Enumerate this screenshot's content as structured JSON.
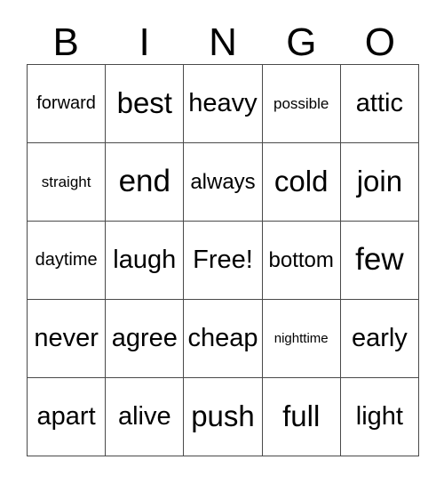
{
  "card": {
    "title": "Bingo Card",
    "background_color": "#ffffff",
    "text_color": "#000000",
    "grid_line_color": "#4a4a4a",
    "columns": 5,
    "rows": 5
  },
  "header": {
    "letters": [
      "B",
      "I",
      "N",
      "G",
      "O"
    ]
  },
  "grid": {
    "rows": [
      {
        "cells": [
          {
            "text": "forward",
            "free_space": false
          },
          {
            "text": "best",
            "free_space": false
          },
          {
            "text": "heavy",
            "free_space": false
          },
          {
            "text": "possible",
            "free_space": false
          },
          {
            "text": "attic",
            "free_space": false
          }
        ]
      },
      {
        "cells": [
          {
            "text": "straight",
            "free_space": false
          },
          {
            "text": "end",
            "free_space": false
          },
          {
            "text": "always",
            "free_space": false
          },
          {
            "text": "cold",
            "free_space": false
          },
          {
            "text": "join",
            "free_space": false
          }
        ]
      },
      {
        "cells": [
          {
            "text": "daytime",
            "free_space": false
          },
          {
            "text": "laugh",
            "free_space": false
          },
          {
            "text": "Free!",
            "free_space": true
          },
          {
            "text": "bottom",
            "free_space": false
          },
          {
            "text": "few",
            "free_space": false
          }
        ]
      },
      {
        "cells": [
          {
            "text": "never",
            "free_space": false
          },
          {
            "text": "agree",
            "free_space": false
          },
          {
            "text": "cheap",
            "free_space": false
          },
          {
            "text": "nighttime",
            "free_space": false
          },
          {
            "text": "early",
            "free_space": false
          }
        ]
      },
      {
        "cells": [
          {
            "text": "apart",
            "free_space": false
          },
          {
            "text": "alive",
            "free_space": false
          },
          {
            "text": "push",
            "free_space": false
          },
          {
            "text": "full",
            "free_space": false
          },
          {
            "text": "light",
            "free_space": false
          }
        ]
      }
    ]
  }
}
